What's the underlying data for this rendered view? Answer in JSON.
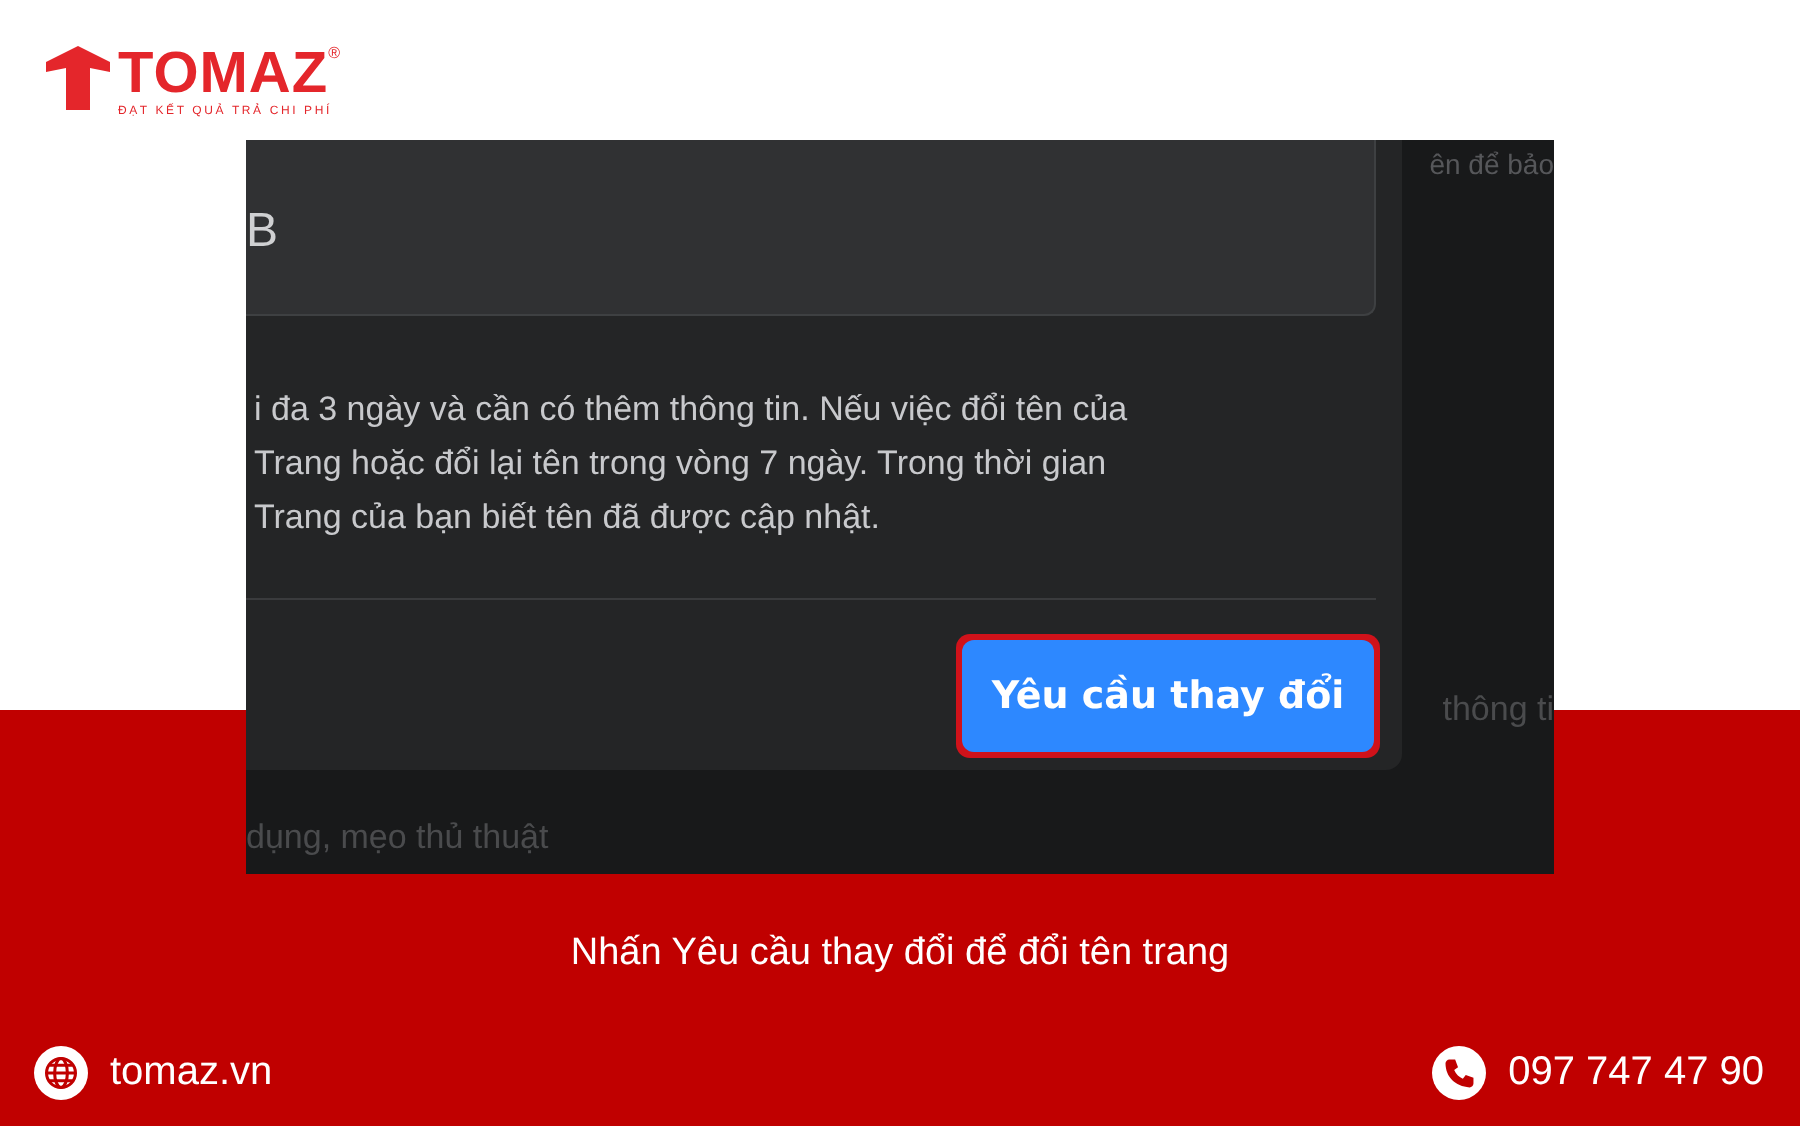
{
  "brand": {
    "name": "TOMAZ",
    "registered": "®",
    "tagline": "ĐẠT KẾT QUẢ TRẢ CHI PHÍ"
  },
  "screenshot": {
    "background_texts": [
      {
        "text": "ên để bảo",
        "kind": "top"
      },
      {
        "text": "thông ti",
        "kind": "right"
      },
      {
        "text": "dụng, mẹo thủ thuật",
        "kind": "line2"
      }
    ],
    "dialog": {
      "field_value": "B",
      "description_lines": [
        "i đa 3 ngày và cần có thêm thông tin. Nếu việc đổi tên của",
        "Trang hoặc đổi lại tên trong vòng 7 ngày. Trong thời gian",
        "Trang của bạn biết tên đã được cập nhật."
      ],
      "button": {
        "label": "Yêu cầu thay đổi",
        "highlighted": true
      }
    }
  },
  "caption": "Nhấn Yêu cầu thay đổi để đổi tên trang",
  "footer": {
    "website": "tomaz.vn",
    "phone": "097 747 47 90"
  }
}
